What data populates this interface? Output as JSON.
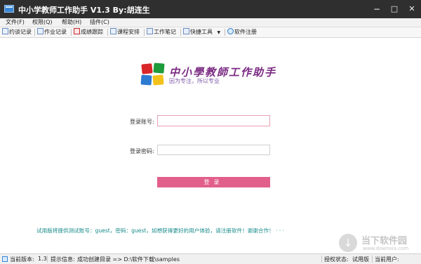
{
  "window": {
    "title": "中小学教师工作助手 V1.3  By:胡连生",
    "minimize": "−",
    "maximize": "□",
    "close": "✕"
  },
  "menu": {
    "items": [
      "文件(F)",
      "权限(Q)",
      "帮助(H)",
      "插件(C)"
    ]
  },
  "toolbar": {
    "items": [
      "约谈记录",
      "作业记录",
      "成绩跟踪",
      "课程安排",
      "工作笔记",
      "快捷工具",
      "软件注册"
    ],
    "dropdown_arrow": "▼"
  },
  "logo": {
    "title": "中小學教師工作助手",
    "subtitle": "因为专注，所以专业",
    "colors": [
      "#d9262b",
      "#1e9b3a",
      "#f2c21b",
      "#2d7bd1"
    ]
  },
  "login": {
    "account_label": "登录账号:",
    "password_label": "登录密码:",
    "account_value": "",
    "password_value": "",
    "button_label": "登录"
  },
  "notice": "试用版将提供测试账号：guest，密码：guest，如想获得更好的用户体验，请注册软件！谢谢合作！ · · ·",
  "watermark": {
    "icon": "↓",
    "main": "当下软件园",
    "sub": "www.downxia.com"
  },
  "status": {
    "version_label": "当前版本:",
    "version_value": "1.3",
    "info_label": "提示信息:",
    "info_value": "成功创建目录 => D:\\软件下载\\samples",
    "license_label": "授权状态:",
    "license_value": "试用版",
    "user_label": "当前用户:",
    "user_value": ""
  },
  "colors": {
    "titlebar": "#2f2f2f",
    "login_button": "#e15f8a",
    "account_border": "#e8a0b4",
    "notice_text": "#178a8a"
  }
}
